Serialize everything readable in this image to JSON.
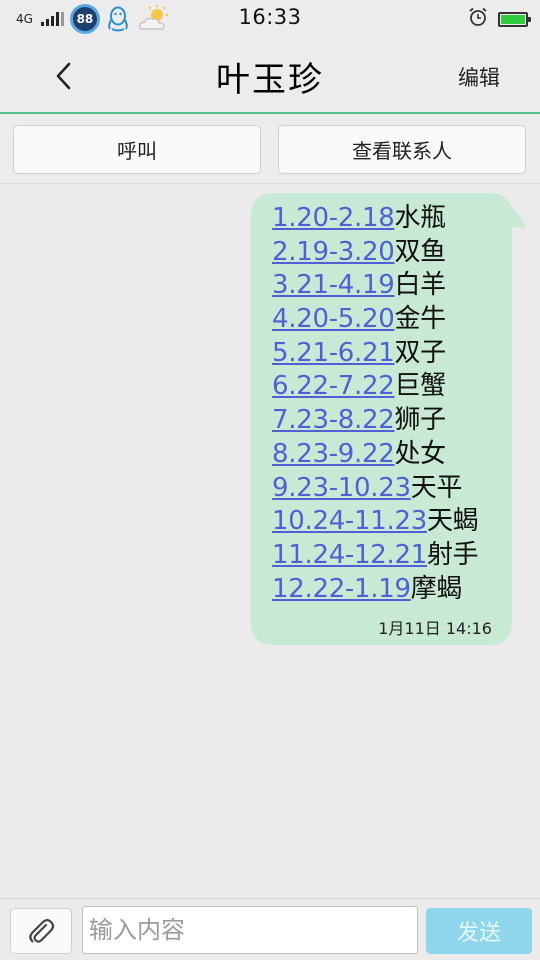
{
  "status_bar": {
    "network": "4G",
    "badge": "88",
    "time": "16:33"
  },
  "title_bar": {
    "contact_name": "叶玉珍",
    "edit_label": "编辑"
  },
  "actions": {
    "call_label": "呼叫",
    "view_contact_label": "查看联系人"
  },
  "message": {
    "lines": [
      {
        "date_range": "1.20-2.18",
        "sign": "水瓶"
      },
      {
        "date_range": "2.19-3.20",
        "sign": "双鱼"
      },
      {
        "date_range": "3.21-4.19",
        "sign": "白羊"
      },
      {
        "date_range": "4.20-5.20",
        "sign": "金牛"
      },
      {
        "date_range": "5.21-6.21",
        "sign": "双子"
      },
      {
        "date_range": "6.22-7.22",
        "sign": "巨蟹"
      },
      {
        "date_range": "7.23-8.22",
        "sign": "狮子"
      },
      {
        "date_range": "8.23-9.22",
        "sign": "处女"
      },
      {
        "date_range": "9.23-10.23",
        "sign": "天平"
      },
      {
        "date_range": "10.24-11.23",
        "sign": "天蝎"
      },
      {
        "date_range": "11.24-12.21",
        "sign": "射手"
      },
      {
        "date_range": "12.22-1.19",
        "sign": "摩蝎"
      }
    ],
    "timestamp": "1月11日 14:16"
  },
  "input_bar": {
    "placeholder": "输入内容",
    "value": "",
    "send_label": "发送"
  },
  "colors": {
    "accent_green": "#4fbf8c",
    "bubble_bg": "#c8ead4",
    "link_blue": "#4f5fd6",
    "send_button": "#8fd6ec"
  },
  "icons": {
    "back": "chevron-left-icon",
    "attach": "paperclip-icon",
    "qq": "qq-penguin-icon",
    "weather": "weather-partly-sunny-icon",
    "alarm": "alarm-clock-icon",
    "battery": "battery-icon",
    "signal": "signal-bars-icon"
  }
}
